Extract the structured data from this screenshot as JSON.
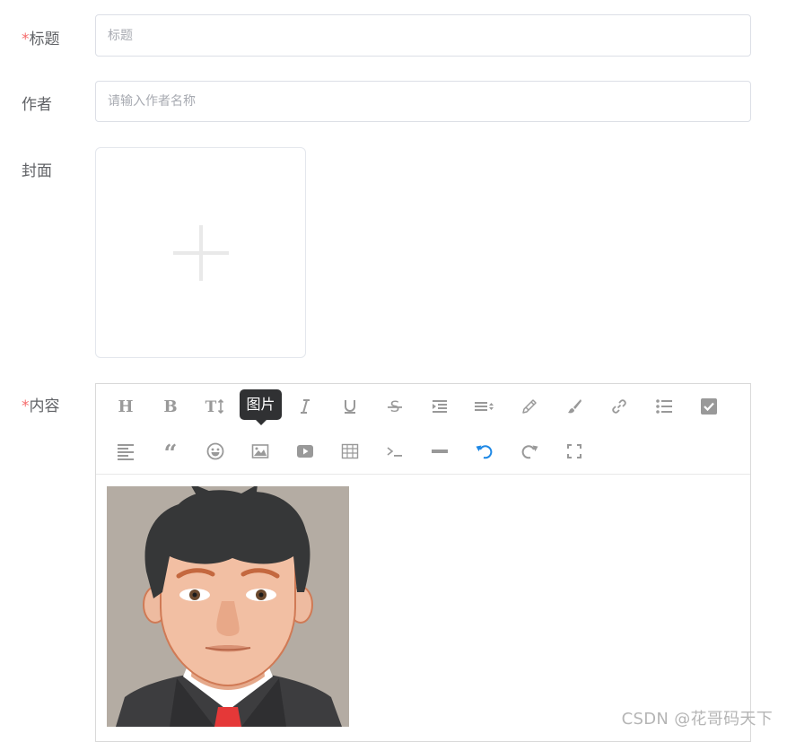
{
  "form": {
    "title": {
      "required_mark": "*",
      "label": "标题",
      "placeholder": "标题",
      "value": ""
    },
    "author": {
      "label": "作者",
      "placeholder": "请输入作者名称",
      "value": ""
    },
    "cover": {
      "label": "封面"
    },
    "content": {
      "required_mark": "*",
      "label": "内容"
    }
  },
  "editor": {
    "tooltip": "图片",
    "toolbar_row1": [
      {
        "name": "heading-icon",
        "glyph": "H"
      },
      {
        "name": "bold-icon",
        "glyph": "B"
      },
      {
        "name": "font-size-icon",
        "glyph": "T↕"
      },
      {
        "name": "image-icon-hover-target",
        "glyph": ""
      },
      {
        "name": "italic-icon",
        "glyph": "I"
      },
      {
        "name": "underline-icon",
        "glyph": "U"
      },
      {
        "name": "strikethrough-icon",
        "glyph": "S"
      },
      {
        "name": "indent-icon",
        "glyph": ""
      },
      {
        "name": "line-height-icon",
        "glyph": ""
      },
      {
        "name": "font-color-icon",
        "glyph": ""
      },
      {
        "name": "background-color-icon",
        "glyph": ""
      },
      {
        "name": "link-icon",
        "glyph": ""
      },
      {
        "name": "bullet-list-icon",
        "glyph": ""
      },
      {
        "name": "todo-checkbox-icon",
        "glyph": ""
      }
    ],
    "toolbar_row2": [
      {
        "name": "align-left-icon"
      },
      {
        "name": "quote-icon"
      },
      {
        "name": "emoji-icon"
      },
      {
        "name": "image-icon"
      },
      {
        "name": "video-icon"
      },
      {
        "name": "table-icon"
      },
      {
        "name": "code-icon"
      },
      {
        "name": "divider-icon"
      },
      {
        "name": "undo-icon"
      },
      {
        "name": "redo-icon"
      },
      {
        "name": "fullscreen-icon"
      }
    ],
    "accent_color": "#1e88e5",
    "icon_color": "#999999"
  },
  "watermark": "CSDN @花哥码天下",
  "colors": {
    "required": "#f56c6c",
    "label": "#606266",
    "border": "#dcdfe6"
  }
}
